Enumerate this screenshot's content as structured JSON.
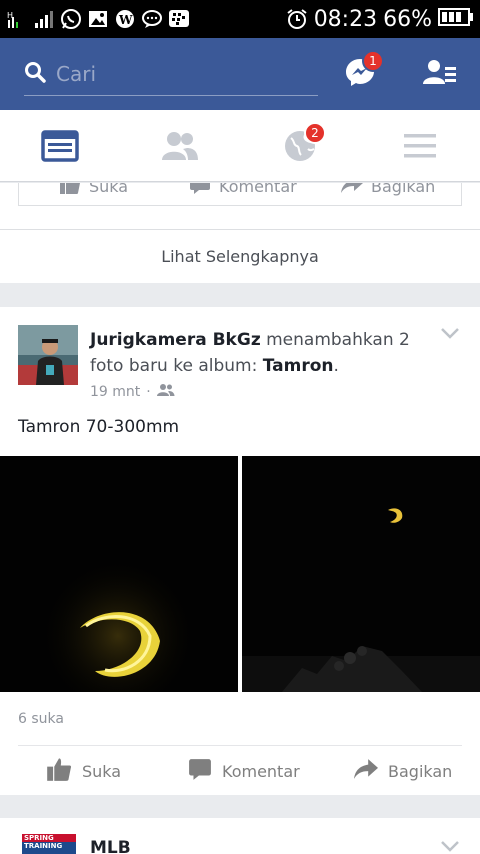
{
  "status_bar": {
    "time": "08:23",
    "battery_percent": "66%",
    "left_icons": [
      "data-icon",
      "signal-icon",
      "whatsapp-icon",
      "gallery-icon",
      "wordpress-icon",
      "chat-icon",
      "bbm-icon"
    ],
    "right_icons": [
      "alarm-icon",
      "battery-icon"
    ]
  },
  "header": {
    "search_placeholder": "Cari",
    "messenger_badge": "1",
    "colors": {
      "brand": "#3b5998",
      "badge": "#e4322b"
    }
  },
  "tabs": [
    {
      "name": "news-feed",
      "icon": "news-feed-icon",
      "active": true
    },
    {
      "name": "friends",
      "icon": "friends-icon",
      "active": false
    },
    {
      "name": "notifications",
      "icon": "globe-icon",
      "badge": "2",
      "active": false
    },
    {
      "name": "menu",
      "icon": "menu-icon",
      "active": false
    }
  ],
  "previous_post": {
    "actions": {
      "like": "Suka",
      "comment": "Komentar",
      "share": "Bagikan"
    },
    "see_more": "Lihat Selengkapnya"
  },
  "post": {
    "author": "Jurigkamera BkGz",
    "action_text": "menambahkan 2 foto baru ke album:",
    "album": "Tamron",
    "period": ".",
    "time": "19 mnt",
    "separator": "·",
    "caption": "Tamron 70-300mm",
    "likes": "6 suka",
    "actions": {
      "like": "Suka",
      "comment": "Komentar",
      "share": "Bagikan"
    }
  },
  "next_post": {
    "author": "MLB",
    "avatar_text_top": "SPRING",
    "avatar_text_bottom": "TRAINING"
  }
}
